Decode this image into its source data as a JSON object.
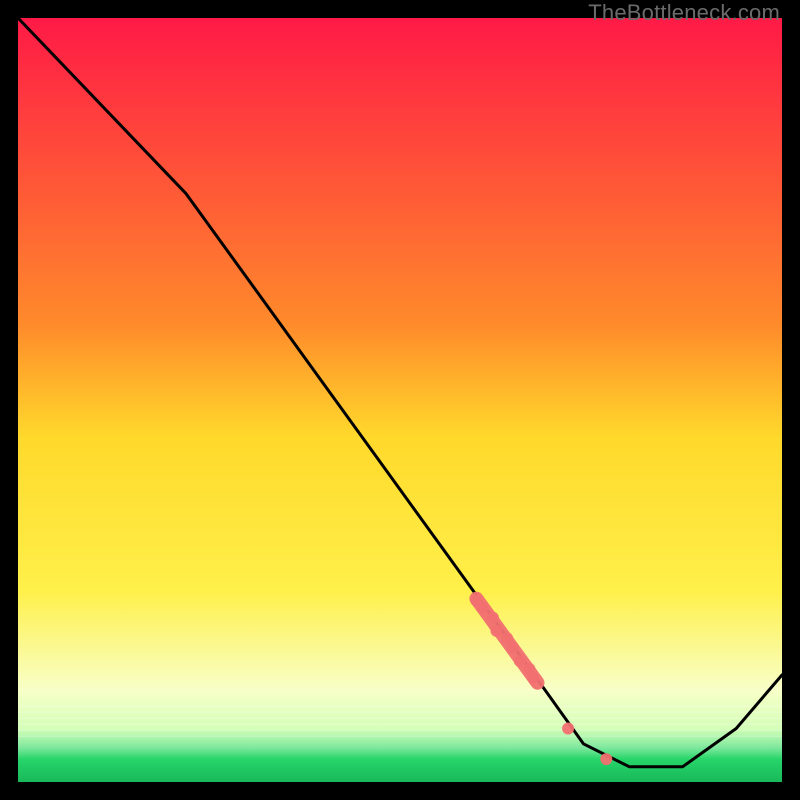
{
  "watermark": "TheBottleneck.com",
  "colors": {
    "frame": "#000000",
    "gradient_top": "#ff1a46",
    "gradient_mid1": "#ffa629",
    "gradient_mid2": "#ffe629",
    "gradient_low": "#f7ffb2",
    "gradient_green": "#27d56a",
    "curve": "#000000",
    "dots": "#f27070"
  },
  "chart_data": {
    "type": "line",
    "title": "",
    "xlabel": "",
    "ylabel": "",
    "xlim": [
      0,
      100
    ],
    "ylim": [
      0,
      100
    ],
    "series": [
      {
        "name": "bottleneck-curve",
        "x": [
          0,
          22,
          69,
          74,
          80,
          87,
          94,
          100
        ],
        "values": [
          100,
          77,
          12,
          5,
          2,
          2,
          7,
          14
        ]
      }
    ],
    "dot_band": {
      "name": "highlight-dots",
      "start": {
        "x": 60,
        "y": 24
      },
      "end": {
        "x": 68,
        "y": 13
      },
      "extra_points": [
        {
          "x": 72,
          "y": 7
        },
        {
          "x": 77,
          "y": 3
        }
      ]
    }
  }
}
